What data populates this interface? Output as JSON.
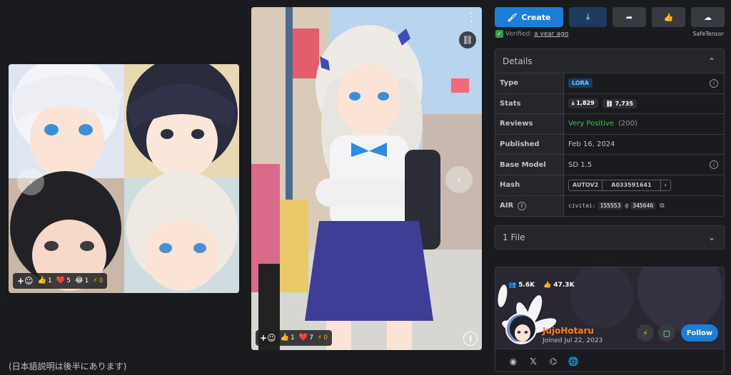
{
  "gallery": {
    "card1": {
      "reactions": {
        "like": "1",
        "heart": "5",
        "laugh": "1",
        "buzz": "0"
      }
    },
    "card2": {
      "reactions": {
        "like": "1",
        "heart": "7",
        "buzz": "0"
      }
    },
    "description": "(日本語説明は後半にあります)"
  },
  "actions": {
    "create_label": "Create"
  },
  "verified": {
    "label": "Verified:",
    "ago": "a year ago",
    "safetensor": "SafeTensor"
  },
  "details": {
    "title": "Details",
    "rows": {
      "type": {
        "label": "Type",
        "value": "LORA"
      },
      "stats": {
        "label": "Stats",
        "downloads": "1,829",
        "generations": "7,735"
      },
      "reviews": {
        "label": "Reviews",
        "rating": "Very Positive",
        "count": "(200)"
      },
      "published": {
        "label": "Published",
        "value": "Feb 16, 2024"
      },
      "base_model": {
        "label": "Base Model",
        "value": "SD 1.5"
      },
      "hash": {
        "label": "Hash",
        "algo": "AUTOV2",
        "value": "A033591641"
      },
      "air": {
        "label": "AIR",
        "prefix": "civitai:",
        "model_id": "155553",
        "at": "@",
        "version_id": "345646"
      }
    }
  },
  "files": {
    "title": "1 File"
  },
  "creator": {
    "followers": "5.6K",
    "likes": "47.3K",
    "name": "JujoHotaru",
    "joined": "Joined Jul 22, 2023",
    "follow_label": "Follow"
  },
  "colors": {
    "accent": "#1c7ed6",
    "creator_name": "#fd7e14",
    "positive": "#40c057",
    "background": "#1a1b1e"
  }
}
